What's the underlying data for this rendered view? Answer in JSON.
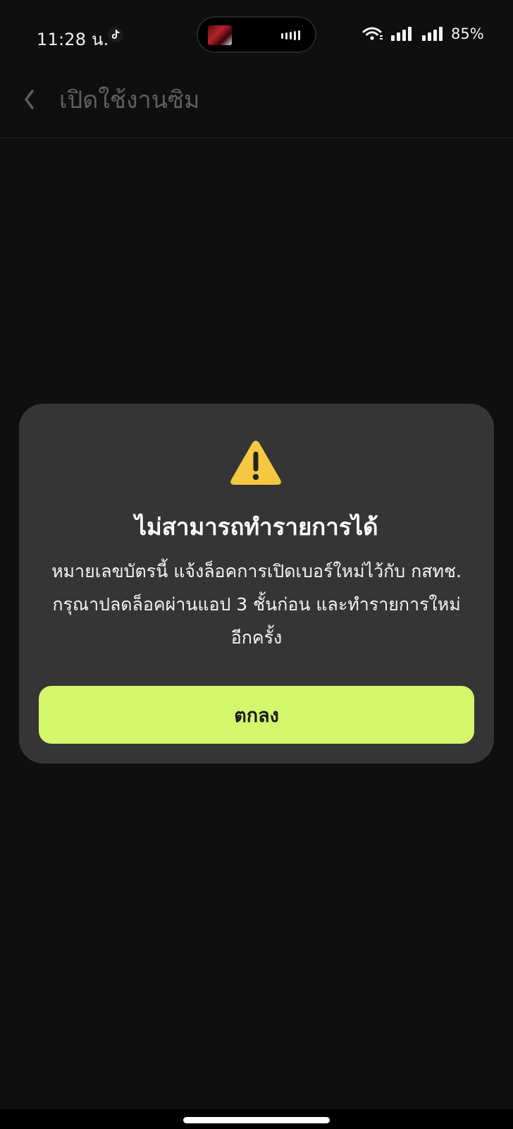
{
  "status_bar": {
    "time": "11:28 น.",
    "battery": "85%",
    "icons": [
      "tiktok-icon",
      "wifi-icon",
      "signal-icon",
      "signal-icon"
    ]
  },
  "header": {
    "title": "เปิดใช้งานซิม",
    "back_icon": "chevron-left-icon"
  },
  "dialog": {
    "icon": "warning-icon",
    "title": "ไม่สามารถทำรายการได้",
    "message_lines": [
      "หมายเลขบัตรนี้ แจ้งล็อคการเปิดเบอร์ใหม่ไว้กับ กสทช.",
      "กรุณาปลดล็อคผ่านแอป 3 ชั้นก่อน และทำรายการใหม่",
      "อีกครั้ง"
    ],
    "confirm_label": "ตกลง"
  },
  "colors": {
    "background": "#0f0f0f",
    "dialog_background": "#353535",
    "accent_button": "#d4f56c",
    "warning": "#f5c842",
    "header_text": "#5e5e5e"
  }
}
